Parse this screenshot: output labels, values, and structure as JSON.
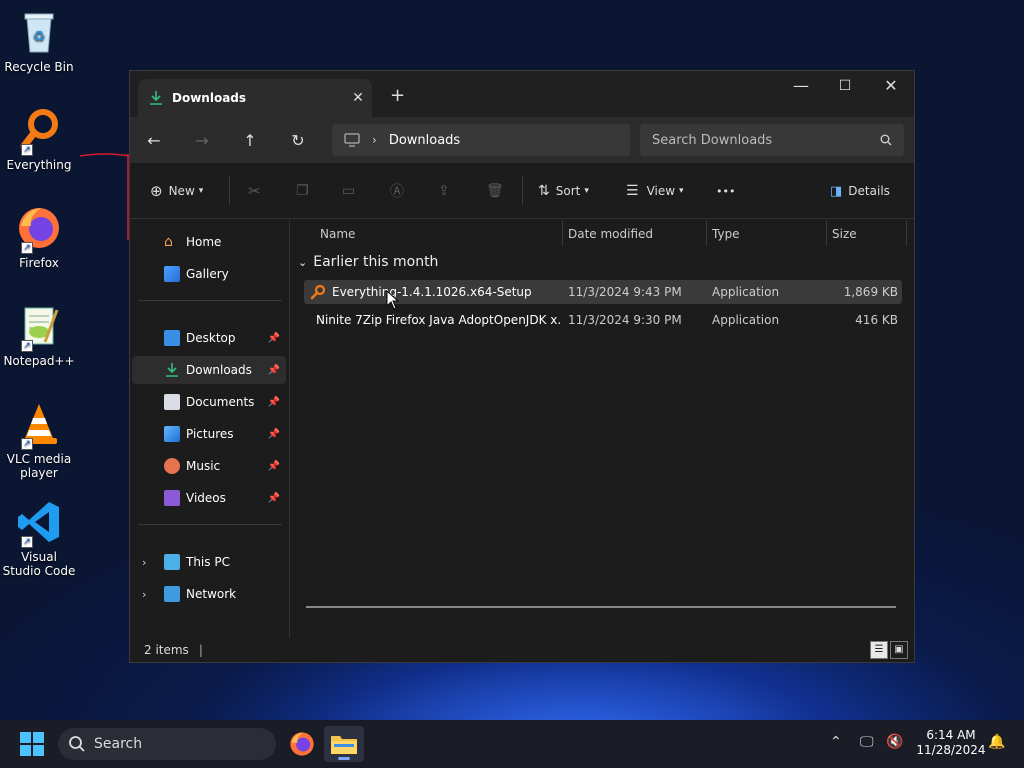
{
  "desktop": {
    "icons": [
      {
        "label": "Recycle Bin",
        "icon": "recycle-bin-icon"
      },
      {
        "label": "Everything",
        "icon": "everything-search-icon"
      },
      {
        "label": "Firefox",
        "icon": "firefox-icon"
      },
      {
        "label": "Notepad++",
        "icon": "notepad-plus-plus-icon"
      },
      {
        "label": "VLC media player",
        "icon": "vlc-icon"
      },
      {
        "label": "Visual Studio Code",
        "icon": "vscode-icon"
      }
    ]
  },
  "window": {
    "tab_title": "Downloads",
    "new_tab": "+",
    "controls": {
      "minimize": "—",
      "maximize": "☐",
      "close": "✕"
    },
    "address": {
      "crumb": "Downloads"
    },
    "search": {
      "placeholder": "Search Downloads"
    },
    "commands": {
      "new": "New",
      "sort": "Sort",
      "view": "View",
      "more": "•••",
      "details": "Details"
    },
    "nav": {
      "home": "Home",
      "gallery": "Gallery",
      "desktop": "Desktop",
      "downloads": "Downloads",
      "documents": "Documents",
      "pictures": "Pictures",
      "music": "Music",
      "videos": "Videos",
      "this_pc": "This PC",
      "network": "Network"
    },
    "columns": {
      "name": "Name",
      "date": "Date modified",
      "type": "Type",
      "size": "Size"
    },
    "group": "Earlier this month",
    "files": [
      {
        "name": "Everything-1.4.1.1026.x64-Setup",
        "date": "11/3/2024 9:43 PM",
        "type": "Application",
        "size": "1,869 KB"
      },
      {
        "name": "Ninite 7Zip Firefox Java AdoptOpenJDK x...",
        "date": "11/3/2024 9:30 PM",
        "type": "Application",
        "size": "416 KB"
      }
    ],
    "status": "2 items"
  },
  "taskbar": {
    "search_label": "Search",
    "time": "6:14 AM",
    "date": "11/28/2024"
  },
  "colors": {
    "accent": "#0078d4",
    "download_green": "#2fc27a"
  }
}
